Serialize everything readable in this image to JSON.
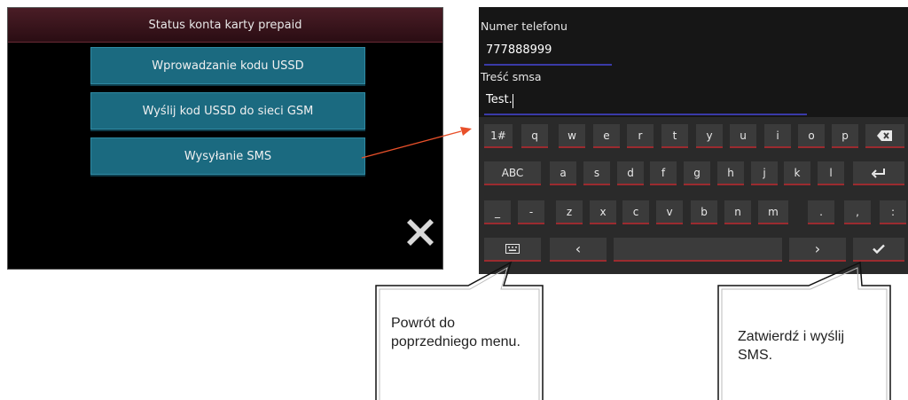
{
  "left_screen": {
    "title": "Status konta karty prepaid",
    "buttons": [
      "Wprowadzanie kodu USSD",
      "Wyślij kod USSD do sieci GSM",
      "Wysyłanie SMS"
    ],
    "close_icon": "close-x-icon"
  },
  "sms_form": {
    "phone_label": "Numer telefonu",
    "phone_value": "777888999",
    "message_label": "Treść smsa",
    "message_value": "Test."
  },
  "keyboard": {
    "row1": [
      "1#",
      "q",
      "w",
      "e",
      "r",
      "t",
      "y",
      "u",
      "i",
      "o",
      "p"
    ],
    "row2": [
      "ABC",
      "a",
      "s",
      "d",
      "f",
      "g",
      "h",
      "j",
      "k",
      "l"
    ],
    "row3": [
      "_",
      "-",
      "z",
      "x",
      "c",
      "v",
      "b",
      "n",
      "m",
      ".",
      ",",
      ":"
    ],
    "icons": {
      "backspace": "backspace-icon",
      "enter": "enter-icon",
      "keyboard": "keyboard-icon",
      "left": "chevron-left-icon",
      "right": "chevron-right-icon",
      "confirm": "checkmark-icon"
    },
    "left_arrow": "‹",
    "right_arrow": "›"
  },
  "callouts": {
    "back": "Powrót do poprzedniego menu.",
    "confirm": "Zatwierdź i wyślij SMS."
  },
  "colors": {
    "button": "#1b6a80",
    "key_underline": "#9b2b2f",
    "field_underline": "#3a3aa8",
    "arrow": "#e8502a"
  }
}
